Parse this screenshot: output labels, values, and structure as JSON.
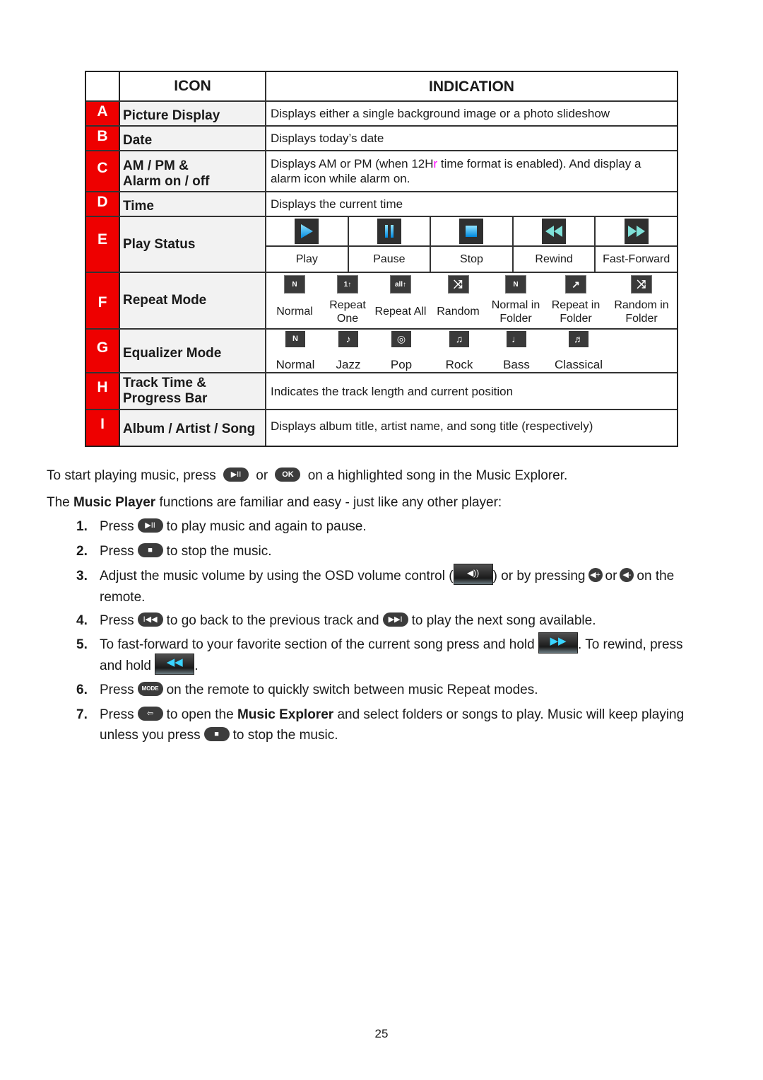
{
  "table": {
    "header": {
      "icon": "ICON",
      "indication": "INDICATION"
    },
    "rows": [
      {
        "letter": "A",
        "name": "Picture Display",
        "indication": "Displays either a single background image or a photo slideshow"
      },
      {
        "letter": "B",
        "name": "Date",
        "indication": "Displays today’s date"
      },
      {
        "letter": "C",
        "name_line1": "AM / PM &",
        "name_line2": "Alarm on / off",
        "indication_pre": "Displays AM or PM (when 12H",
        "indication_highlight": "r",
        "indication_post": " time format is enabled). And display a",
        "indication_line2": "alarm icon while alarm on."
      },
      {
        "letter": "D",
        "name": "Time",
        "indication": "Displays the current time"
      },
      {
        "letter": "E",
        "name": "Play Status",
        "items": [
          {
            "icon": "play-icon",
            "label": "Play"
          },
          {
            "icon": "pause-icon",
            "label": "Pause"
          },
          {
            "icon": "stop-icon",
            "label": "Stop"
          },
          {
            "icon": "rewind-icon",
            "label": "Rewind"
          },
          {
            "icon": "fast-forward-icon",
            "label": "Fast-Forward"
          }
        ]
      },
      {
        "letter": "F",
        "name": "Repeat Mode",
        "items": [
          {
            "icon": "repeat-normal-icon",
            "glyph": "N",
            "label": "Normal"
          },
          {
            "icon": "repeat-one-icon",
            "glyph": "1↑",
            "label": "Repeat One"
          },
          {
            "icon": "repeat-all-icon",
            "glyph": "all↑",
            "label": "Repeat All"
          },
          {
            "icon": "random-icon",
            "glyph": "⤨",
            "label": "Random"
          },
          {
            "icon": "normal-in-folder-icon",
            "glyph": "N",
            "label": "Normal in Folder"
          },
          {
            "icon": "repeat-in-folder-icon",
            "glyph": "↗",
            "label": "Repeat in Folder"
          },
          {
            "icon": "random-in-folder-icon",
            "glyph": "⤨",
            "label": "Random in Folder"
          }
        ]
      },
      {
        "letter": "G",
        "name": "Equalizer Mode",
        "items": [
          {
            "icon": "eq-normal-icon",
            "glyph": "N",
            "label": "Normal"
          },
          {
            "icon": "saxophone-icon",
            "glyph": "♪",
            "label": "Jazz"
          },
          {
            "icon": "drum-icon",
            "glyph": "◎",
            "label": "Pop"
          },
          {
            "icon": "electric-guitar-icon",
            "glyph": "♫",
            "label": "Rock"
          },
          {
            "icon": "bass-guitar-icon",
            "glyph": "♩",
            "label": "Bass"
          },
          {
            "icon": "piano-icon",
            "glyph": "♬",
            "label": "Classical"
          }
        ]
      },
      {
        "letter": "H",
        "name_line1": "Track Time &",
        "name_line2": "Progress Bar",
        "indication": "Indicates the track length and current position"
      },
      {
        "letter": "I",
        "name": "Album / Artist / Song",
        "indication": "Displays album title, artist name, and song title (respectively)"
      }
    ]
  },
  "intro": {
    "line1_a": "To start playing music, press",
    "line1_or": "or",
    "line1_b": "on a highlighted song in the Music Explorer.",
    "ok_label": "OK",
    "line2_pre": "The ",
    "line2_bold": "Music Player",
    "line2_post": " functions are familiar and easy - just like any other player:"
  },
  "buttons": {
    "play_pause": "▶II",
    "stop": "■",
    "prev": "I◀◀",
    "next": "▶▶I",
    "mode": "MODE",
    "explorer": "⇦",
    "vol_up": "◀+",
    "vol_down": "◀-",
    "osd_volume": "◀))",
    "osd_ff": "▶▶",
    "osd_rew": "◀◀"
  },
  "steps": [
    {
      "num": "1.",
      "a": "Press",
      "b": "to play music and again to pause."
    },
    {
      "num": "2.",
      "a": "Press",
      "b": "to stop the music."
    },
    {
      "num": "3.",
      "a": "Adjust the music volume by using the OSD volume control (",
      "b": ") or by pressing",
      "c": "or",
      "d": "on the",
      "e": "remote."
    },
    {
      "num": "4.",
      "a": "Press",
      "b": "to go back to the previous track and",
      "c": "to play the next song available."
    },
    {
      "num": "5.",
      "a": "To fast-forward to your favorite section of the current song press and hold",
      "b": ". To rewind, press",
      "c": "and hold",
      "d": "."
    },
    {
      "num": "6.",
      "a": "Press",
      "b": "on the remote to quickly switch between music Repeat modes."
    },
    {
      "num": "7.",
      "a": "Press",
      "b": "to open the ",
      "bold": "Music Explorer",
      "c": " and select folders or songs to play. Music will keep playing",
      "d": "unless you press",
      "e": "to stop the music."
    }
  ],
  "page_number": "25"
}
